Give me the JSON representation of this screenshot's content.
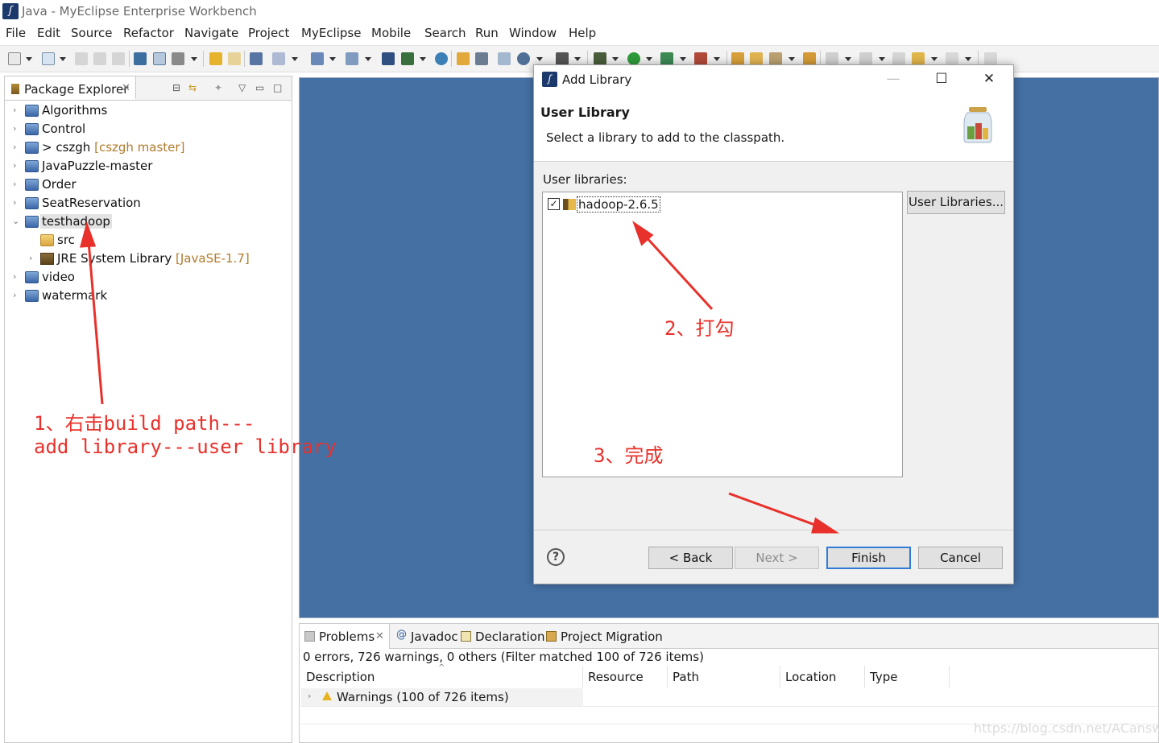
{
  "window": {
    "title": "Java - MyEclipse Enterprise Workbench"
  },
  "menu": [
    "File",
    "Edit",
    "Source",
    "Refactor",
    "Navigate",
    "Project",
    "MyEclipse",
    "Mobile",
    "Search",
    "Run",
    "Window",
    "Help"
  ],
  "package_explorer": {
    "tab_label": "Package Explorer",
    "tree": [
      {
        "label": "Algorithms",
        "decoration": ""
      },
      {
        "label": "Control",
        "decoration": ""
      },
      {
        "label": "> cszgh",
        "decoration": "[cszgh master]"
      },
      {
        "label": "JavaPuzzle-master",
        "decoration": ""
      },
      {
        "label": "Order",
        "decoration": ""
      },
      {
        "label": "SeatReservation",
        "decoration": ""
      },
      {
        "label": "testhadoop",
        "decoration": ""
      },
      {
        "label": "src",
        "decoration": ""
      },
      {
        "label": "JRE System Library",
        "decoration": "[JavaSE-1.7]"
      },
      {
        "label": "video",
        "decoration": ""
      },
      {
        "label": "watermark",
        "decoration": ""
      }
    ]
  },
  "dialog": {
    "title": "Add Library",
    "header_title": "User Library",
    "header_desc": "Select a library to add to the classpath.",
    "list_label": "User libraries:",
    "library": {
      "name": "hadoop-2.6.5",
      "checked": true
    },
    "user_libraries_button": "User Libraries...",
    "help": "?",
    "buttons": {
      "back": "< Back",
      "next": "Next >",
      "finish": "Finish",
      "cancel": "Cancel"
    }
  },
  "bottom_panel": {
    "tabs": [
      "Problems",
      "Javadoc",
      "Declaration",
      "Project Migration"
    ],
    "summary": "0 errors, 726 warnings, 0 others (Filter matched 100 of 726 items)",
    "columns": [
      "Description",
      "Resource",
      "Path",
      "Location",
      "Type"
    ],
    "rows": [
      {
        "description": "Warnings (100 of 726 items)"
      }
    ]
  },
  "annotations": {
    "step1_line1": "1、右击build path---",
    "step1_line2": "add library---user library",
    "step2": "2、打勾",
    "step3": "3、完成"
  },
  "watermark": "https://blog.csdn.net/ACanswer",
  "colors": {
    "editor_bg": "#4570a4",
    "annotation": "#e8312b",
    "default_button_border": "#2f7bd6"
  }
}
